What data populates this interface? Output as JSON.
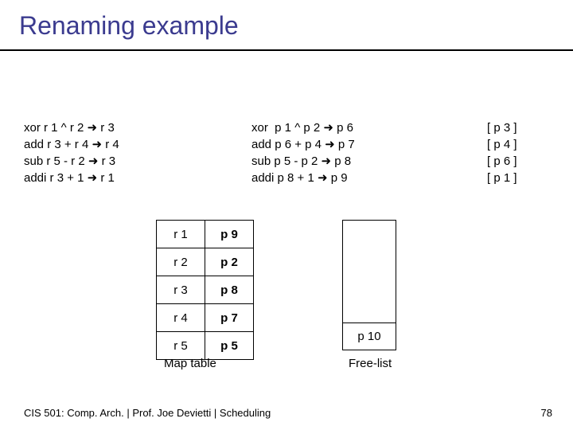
{
  "title": "Renaming example",
  "code_left": "xor r 1 ^ r 2 ➜ r 3\nadd r 3 + r 4 ➜ r 4\nsub r 5 - r 2 ➜ r 3\naddi r 3 + 1 ➜ r 1",
  "code_mid": "xor  p 1 ^ p 2 ➜ p 6\nadd p 6 + p 4 ➜ p 7\nsub p 5 - p 2 ➜ p 8\naddi p 8 + 1 ➜ p 9",
  "code_right": "[ p 3 ]\n[ p 4 ]\n[ p 6 ]\n[ p 1 ]",
  "map_table": {
    "rows": [
      {
        "r": "r 1",
        "p": "p 9"
      },
      {
        "r": "r 2",
        "p": "p 2"
      },
      {
        "r": "r 3",
        "p": "p 8"
      },
      {
        "r": "r 4",
        "p": "p 7"
      },
      {
        "r": "r 5",
        "p": "p 5"
      }
    ],
    "label": "Map table"
  },
  "free_list": {
    "cell": "p 10",
    "label": "Free-list"
  },
  "footer": "CIS 501: Comp. Arch.  |  Prof. Joe Devietti  |  Scheduling",
  "page_number": "78"
}
